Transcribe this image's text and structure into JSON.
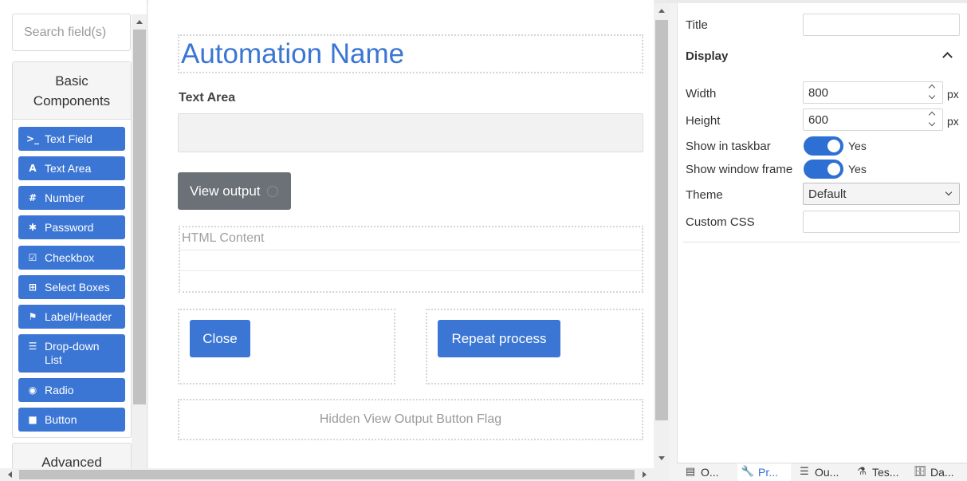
{
  "palette": {
    "search_placeholder": "Search field(s)",
    "basic_title": "Basic Components",
    "advanced_title": "Advanced",
    "components": [
      {
        "label": "Text Field",
        "icon": ">_"
      },
      {
        "label": "Text Area",
        "icon": "A"
      },
      {
        "label": "Number",
        "icon": "#"
      },
      {
        "label": "Password",
        "icon": "✱"
      },
      {
        "label": "Checkbox",
        "icon": "☑"
      },
      {
        "label": "Select Boxes",
        "icon": "⊞"
      },
      {
        "label": "Label/Header",
        "icon": "⚑"
      },
      {
        "label": "Drop-down List",
        "icon": "☰"
      },
      {
        "label": "Radio",
        "icon": "◉"
      },
      {
        "label": "Button",
        "icon": "■"
      }
    ]
  },
  "canvas": {
    "title": "Automation Name",
    "textarea_label": "Text Area",
    "view_output": "View output",
    "html_content": "HTML Content",
    "close": "Close",
    "repeat": "Repeat process",
    "hidden_flag": "Hidden View Output Button Flag"
  },
  "properties": {
    "title_label": "Title",
    "title_value": "",
    "display_header": "Display",
    "width_label": "Width",
    "width_value": "800",
    "height_label": "Height",
    "height_value": "600",
    "unit": "px",
    "show_taskbar_label": "Show in taskbar",
    "show_taskbar_value": "Yes",
    "show_frame_label": "Show window frame",
    "show_frame_value": "Yes",
    "theme_label": "Theme",
    "theme_value": "Default",
    "custom_css_label": "Custom CSS",
    "custom_css_value": ""
  },
  "tabs": [
    {
      "label": "O...",
      "icon": "▤"
    },
    {
      "label": "Pr...",
      "icon": "🔧"
    },
    {
      "label": "Ou...",
      "icon": "☰"
    },
    {
      "label": "Tes...",
      "icon": "⚗"
    },
    {
      "label": "Da...",
      "icon": "🗄"
    }
  ],
  "colors": {
    "accent": "#3b76d4",
    "toggle_on": "#2d6fd3",
    "gray_button": "#6c7177"
  }
}
